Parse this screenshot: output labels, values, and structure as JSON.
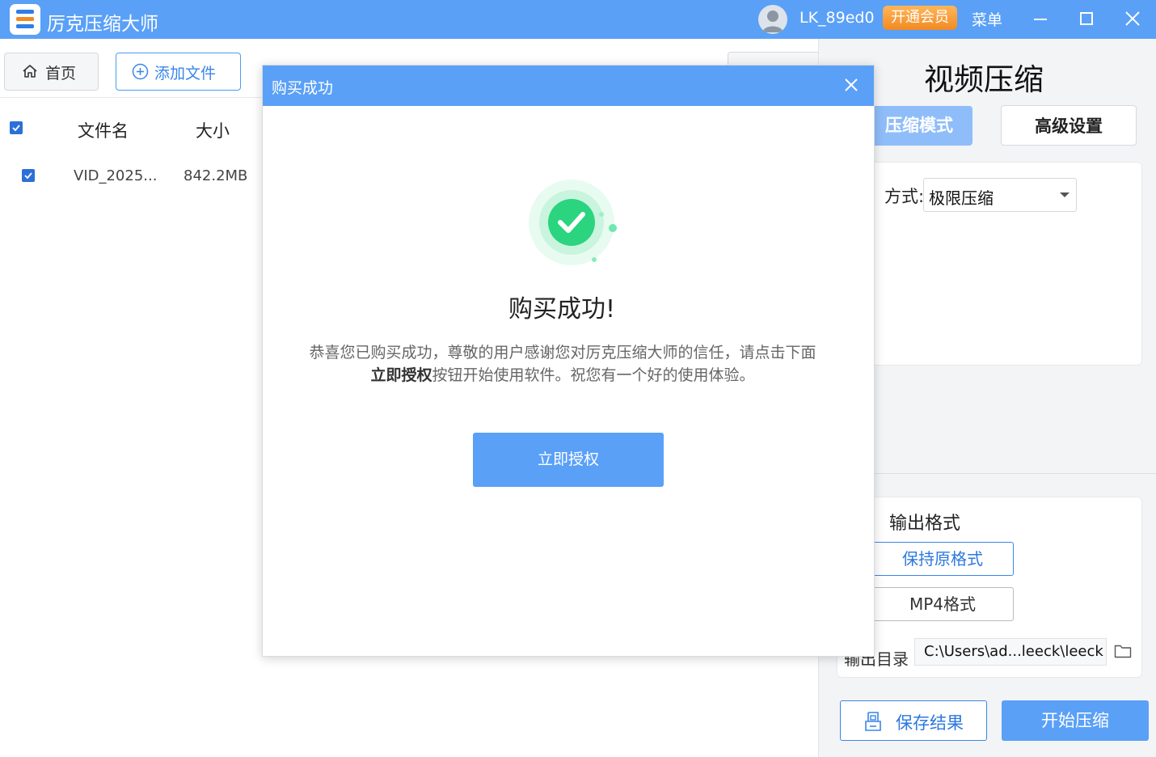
{
  "app": {
    "title": "厉克压缩大师",
    "user_name": "LK_89ed0",
    "vip_label": "开通会员",
    "menu_label": "菜单"
  },
  "toolbar": {
    "home_label": "首页",
    "add_file_label": "添加文件"
  },
  "file_list": {
    "columns": [
      "文件名",
      "大小"
    ],
    "rows": [
      {
        "name": "VID_2025...",
        "size": "842.2MB",
        "checked": true
      }
    ],
    "select_all_checked": true
  },
  "right_panel": {
    "title": "视频压缩",
    "tabs": [
      "压缩模式",
      "高级设置"
    ],
    "mode": {
      "label": "方式:",
      "selected": "极限压缩"
    },
    "output": {
      "title": "输出格式",
      "formats": [
        "保持原格式",
        "MP4格式"
      ],
      "selected_format": "保持原格式",
      "dir_label": "输出目录",
      "dir_value": "C:\\Users\\ad...leeck\\leeck"
    },
    "save_label": "保存结果",
    "start_label": "开始压缩"
  },
  "dialog": {
    "title": "购买成功",
    "heading": "购买成功!",
    "message_pre": "恭喜您已购买成功，尊敬的用户感谢您对厉克压缩大师的信任，请点击下面 ",
    "message_bold": "立即授权",
    "message_post": "按钮开始使用软件。祝您有一个好的使用体验。",
    "button_label": "立即授权"
  },
  "colors": {
    "brand_blue": "#5aa0f7",
    "accent_blue": "#3a86e8",
    "success_green": "#2bd47e",
    "vip_orange": "#f28a22"
  }
}
